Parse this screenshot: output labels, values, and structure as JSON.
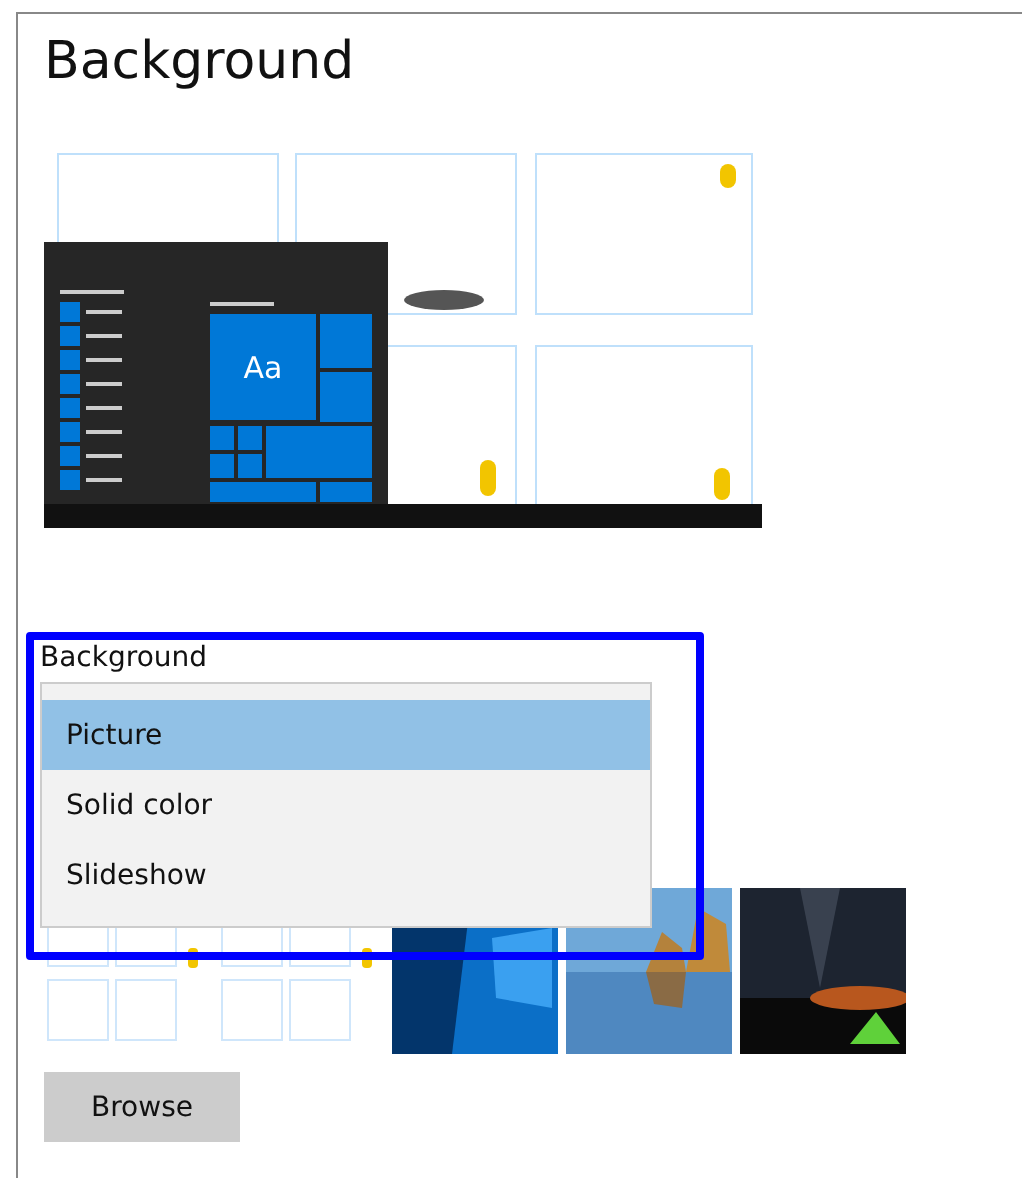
{
  "title": "Background",
  "preview": {
    "tile_text": "Aa"
  },
  "background_select": {
    "label": "Background",
    "options": [
      {
        "label": "Picture",
        "selected": true
      },
      {
        "label": "Solid color",
        "selected": false
      },
      {
        "label": "Slideshow",
        "selected": false
      }
    ]
  },
  "browse_button": "Browse"
}
